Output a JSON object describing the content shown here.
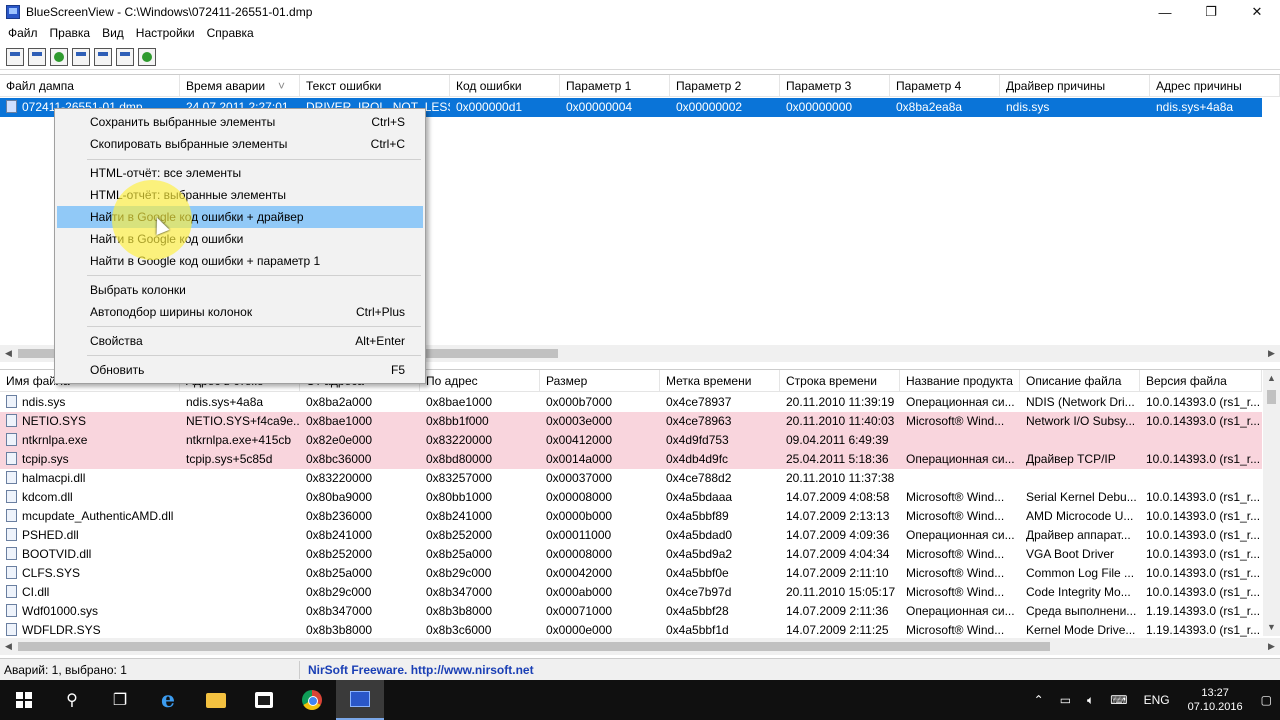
{
  "window": {
    "title": "BlueScreenView  -  C:\\Windows\\072411-26551-01.dmp",
    "minimize": "—",
    "maximize": "❐",
    "close": "✕"
  },
  "menu": [
    "Файл",
    "Правка",
    "Вид",
    "Настройки",
    "Справка"
  ],
  "toolbar": [
    "properties-icon",
    "save-icon",
    "refresh-icon",
    "copy-icon",
    "html-report-icon",
    "find-icon",
    "exit-icon"
  ],
  "upper": {
    "headers": [
      "Файл дампа",
      "Время аварии",
      "Текст ошибки",
      "Код ошибки",
      "Параметр 1",
      "Параметр 2",
      "Параметр 3",
      "Параметр 4",
      "Драйвер причины",
      "Адрес причины"
    ],
    "sort_arrow": "˅",
    "rows": [
      [
        "072411-26551-01.dmp",
        "24.07.2011 2:27:01",
        "DRIVER_IRQL_NOT_LESS...",
        "0x000000d1",
        "0x00000004",
        "0x00000002",
        "0x00000000",
        "0x8ba2ea8a",
        "ndis.sys",
        "ndis.sys+4a8a"
      ]
    ]
  },
  "lower": {
    "headers": [
      "Имя файла",
      "Адрес в стеке",
      "От адреса",
      "По адрес",
      "Размер",
      "Метка времени",
      "Строка времени",
      "Название продукта",
      "Описание файла",
      "Версия файла"
    ],
    "rows": [
      {
        "pink": false,
        "cells": [
          "ndis.sys",
          "ndis.sys+4a8a",
          "0x8ba2a000",
          "0x8bae1000",
          "0x000b7000",
          "0x4ce78937",
          "20.11.2010 11:39:19",
          "Операционная си...",
          "NDIS (Network Dri...",
          "10.0.14393.0 (rs1_r..."
        ]
      },
      {
        "pink": true,
        "cells": [
          "NETIO.SYS",
          "NETIO.SYS+f4ca9e...",
          "0x8bae1000",
          "0x8bb1f000",
          "0x0003e000",
          "0x4ce78963",
          "20.11.2010 11:40:03",
          "Microsoft® Wind...",
          "Network I/O Subsy...",
          "10.0.14393.0 (rs1_r..."
        ]
      },
      {
        "pink": true,
        "cells": [
          "ntkrnlpa.exe",
          "ntkrnlpa.exe+415cb",
          "0x82e0e000",
          "0x83220000",
          "0x00412000",
          "0x4d9fd753",
          "09.04.2011 6:49:39",
          "",
          "",
          ""
        ]
      },
      {
        "pink": true,
        "cells": [
          "tcpip.sys",
          "tcpip.sys+5c85d",
          "0x8bc36000",
          "0x8bd80000",
          "0x0014a000",
          "0x4db4d9fc",
          "25.04.2011 5:18:36",
          "Операционная си...",
          "Драйвер TCP/IP",
          "10.0.14393.0 (rs1_r..."
        ]
      },
      {
        "pink": false,
        "cells": [
          "halmacpi.dll",
          "",
          "0x83220000",
          "0x83257000",
          "0x00037000",
          "0x4ce788d2",
          "20.11.2010 11:37:38",
          "",
          "",
          ""
        ]
      },
      {
        "pink": false,
        "cells": [
          "kdcom.dll",
          "",
          "0x80ba9000",
          "0x80bb1000",
          "0x00008000",
          "0x4a5bdaaa",
          "14.07.2009 4:08:58",
          "Microsoft® Wind...",
          "Serial Kernel Debu...",
          "10.0.14393.0 (rs1_r..."
        ]
      },
      {
        "pink": false,
        "cells": [
          "mcupdate_AuthenticAMD.dll",
          "",
          "0x8b236000",
          "0x8b241000",
          "0x0000b000",
          "0x4a5bbf89",
          "14.07.2009 2:13:13",
          "Microsoft® Wind...",
          "AMD Microcode U...",
          "10.0.14393.0 (rs1_r..."
        ]
      },
      {
        "pink": false,
        "cells": [
          "PSHED.dll",
          "",
          "0x8b241000",
          "0x8b252000",
          "0x00011000",
          "0x4a5bdad0",
          "14.07.2009 4:09:36",
          "Операционная си...",
          "Драйвер аппарат...",
          "10.0.14393.0 (rs1_r..."
        ]
      },
      {
        "pink": false,
        "cells": [
          "BOOTVID.dll",
          "",
          "0x8b252000",
          "0x8b25a000",
          "0x00008000",
          "0x4a5bd9a2",
          "14.07.2009 4:04:34",
          "Microsoft® Wind...",
          "VGA Boot Driver",
          "10.0.14393.0 (rs1_r..."
        ]
      },
      {
        "pink": false,
        "cells": [
          "CLFS.SYS",
          "",
          "0x8b25a000",
          "0x8b29c000",
          "0x00042000",
          "0x4a5bbf0e",
          "14.07.2009 2:11:10",
          "Microsoft® Wind...",
          "Common Log File ...",
          "10.0.14393.0 (rs1_r..."
        ]
      },
      {
        "pink": false,
        "cells": [
          "CI.dll",
          "",
          "0x8b29c000",
          "0x8b347000",
          "0x000ab000",
          "0x4ce7b97d",
          "20.11.2010 15:05:17",
          "Microsoft® Wind...",
          "Code Integrity Mo...",
          "10.0.14393.0 (rs1_r..."
        ]
      },
      {
        "pink": false,
        "cells": [
          "Wdf01000.sys",
          "",
          "0x8b347000",
          "0x8b3b8000",
          "0x00071000",
          "0x4a5bbf28",
          "14.07.2009 2:11:36",
          "Операционная си...",
          "Среда выполнени...",
          "1.19.14393.0 (rs1_r..."
        ]
      },
      {
        "pink": false,
        "cells": [
          "WDFLDR.SYS",
          "",
          "0x8b3b8000",
          "0x8b3c6000",
          "0x0000e000",
          "0x4a5bbf1d",
          "14.07.2009 2:11:25",
          "Microsoft® Wind...",
          "Kernel Mode Drive...",
          "1.19.14393.0 (rs1_r..."
        ]
      }
    ]
  },
  "context_menu": {
    "items": [
      {
        "label": "Сохранить выбранные элементы",
        "shortcut": "Ctrl+S"
      },
      {
        "label": "Скопировать выбранные элементы",
        "shortcut": "Ctrl+C"
      },
      {
        "label": "HTML-отчёт: все элементы",
        "shortcut": ""
      },
      {
        "label": "HTML-отчёт: выбранные элементы",
        "shortcut": ""
      },
      {
        "label": "Найти в Google код ошибки + драйвер",
        "shortcut": ""
      },
      {
        "label": "Найти в Google код ошибки",
        "shortcut": ""
      },
      {
        "label": "Найти в Google код ошибки + параметр 1",
        "shortcut": ""
      },
      {
        "label": "Выбрать колонки",
        "shortcut": ""
      },
      {
        "label": "Автоподбор ширины колонок",
        "shortcut": "Ctrl+Plus"
      },
      {
        "label": "Свойства",
        "shortcut": "Alt+Enter"
      },
      {
        "label": "Обновить",
        "shortcut": "F5"
      }
    ],
    "highlighted_index": 4
  },
  "status": {
    "left": "Аварий: 1, выбрано: 1",
    "right": "NirSoft Freeware.  http://www.nirsoft.net"
  },
  "taskbar": {
    "language": "ENG",
    "time": "13:27",
    "date": "07.10.2016"
  }
}
